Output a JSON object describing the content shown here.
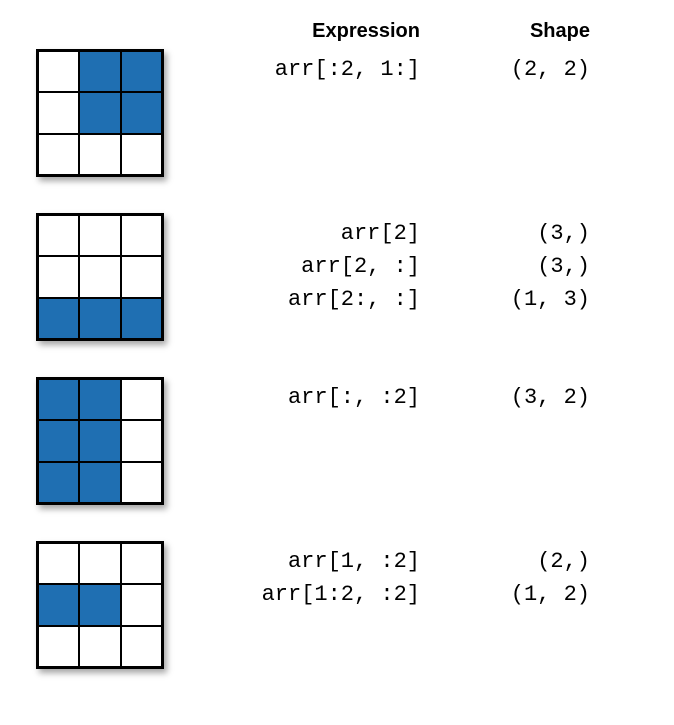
{
  "headers": {
    "expression": "Expression",
    "shape": "Shape"
  },
  "colors": {
    "fill": "#1f6fb2",
    "empty": "#ffffff",
    "border": "#000000"
  },
  "blocks": [
    {
      "grid": [
        [
          0,
          1,
          1
        ],
        [
          0,
          1,
          1
        ],
        [
          0,
          0,
          0
        ]
      ],
      "rows": [
        {
          "expression": "arr[:2, 1:]",
          "shape": "(2, 2)"
        }
      ]
    },
    {
      "grid": [
        [
          0,
          0,
          0
        ],
        [
          0,
          0,
          0
        ],
        [
          1,
          1,
          1
        ]
      ],
      "rows": [
        {
          "expression": "arr[2]",
          "shape": "(3,)"
        },
        {
          "expression": "arr[2, :]",
          "shape": "(3,)"
        },
        {
          "expression": "arr[2:, :]",
          "shape": "(1, 3)"
        }
      ]
    },
    {
      "grid": [
        [
          1,
          1,
          0
        ],
        [
          1,
          1,
          0
        ],
        [
          1,
          1,
          0
        ]
      ],
      "rows": [
        {
          "expression": "arr[:, :2]",
          "shape": "(3, 2)"
        }
      ]
    },
    {
      "grid": [
        [
          0,
          0,
          0
        ],
        [
          1,
          1,
          0
        ],
        [
          0,
          0,
          0
        ]
      ],
      "rows": [
        {
          "expression": "arr[1, :2]",
          "shape": "(2,)"
        },
        {
          "expression": "arr[1:2, :2]",
          "shape": "(1, 2)"
        }
      ]
    }
  ]
}
